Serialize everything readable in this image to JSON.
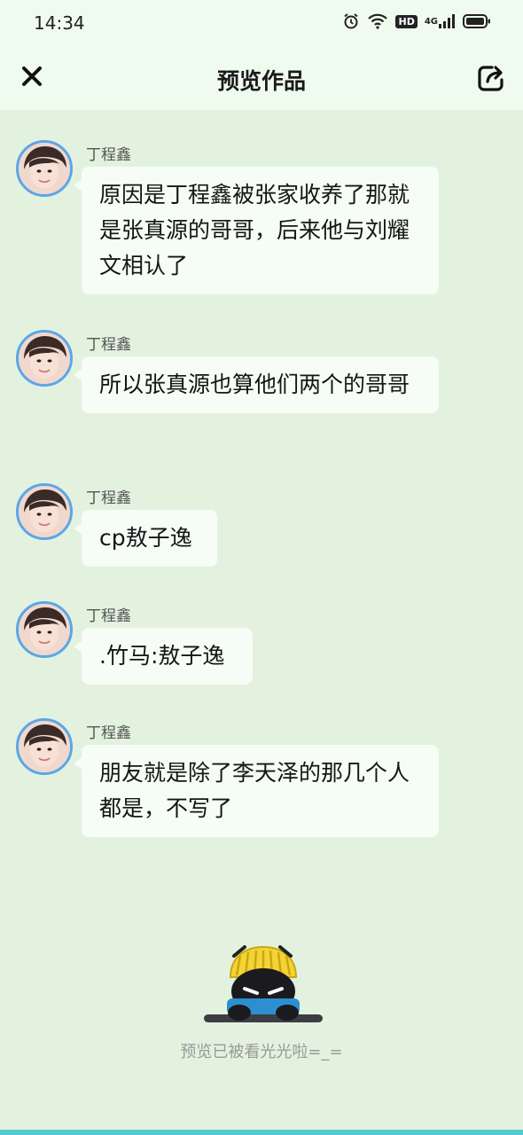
{
  "status_bar": {
    "time": "14:34",
    "hd": "HD",
    "network": "4G"
  },
  "header": {
    "title": "预览作品"
  },
  "messages": [
    {
      "sender": "丁程鑫",
      "text": "原因是丁程鑫被张家收养了那就是张真源的哥哥，后来他与刘耀文相认了"
    },
    {
      "sender": "丁程鑫",
      "text": "所以张真源也算他们两个的哥哥"
    },
    {
      "sender": "丁程鑫",
      "text": "cp敖子逸"
    },
    {
      "sender": "丁程鑫",
      "text": ".竹马:敖子逸"
    },
    {
      "sender": "丁程鑫",
      "text": "朋友就是除了李天泽的那几个人都是，不写了"
    }
  ],
  "footer": {
    "text": "预览已被看光光啦=_="
  },
  "colors": {
    "background": "#e2f2df",
    "bubble": "#f6fcf6",
    "avatar_border": "#5aa6e8",
    "bottom_strip": "#57c7d0"
  }
}
